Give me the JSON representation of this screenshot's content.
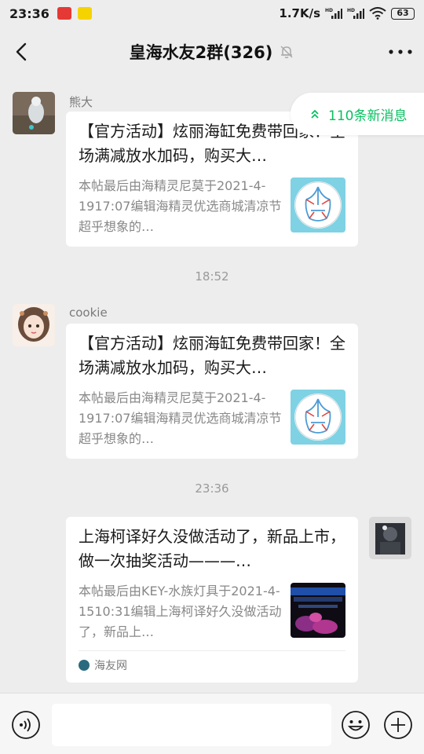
{
  "status_bar": {
    "time": "23:36",
    "network_speed": "1.7K/s",
    "signal_label_1": "HD",
    "signal_label_2": "HD",
    "battery": "63"
  },
  "header": {
    "title": "皇海水友2群(326)",
    "icons": [
      "back-icon",
      "mute-bell-icon",
      "more-icon"
    ]
  },
  "new_messages": {
    "label": "110条新消息",
    "icon": "double-chevron-up-icon",
    "accent": "#07c160"
  },
  "messages": [
    {
      "sender": "熊大",
      "title": "【官方活动】炫丽海缸免费带回家！全场满减放水加码，购买大…",
      "description": "本帖最后由海精灵尼莫于2021-4-1917:07编辑海精灵优选商城清凉节超乎想象的…",
      "thumbnail": "circular-logo"
    },
    {
      "time": "18:52"
    },
    {
      "sender": "cookie",
      "title": "【官方活动】炫丽海缸免费带回家！全场满减放水加码，购买大…",
      "description": "本帖最后由海精灵尼莫于2021-4-1917:07编辑海精灵优选商城清凉节超乎想象的…",
      "thumbnail": "circular-logo"
    },
    {
      "time": "23:36"
    },
    {
      "sender": "me",
      "title": "上海柯译好久没做活动了，新品上市，做一次抽奖活动———…",
      "description": "本帖最后由KEY-水族灯具于2021-4-1510:31编辑上海柯译好久没做活动了，新品上…",
      "thumbnail": "aquarium-lamp-photo",
      "source": "海友网"
    }
  ],
  "input_bar": {
    "placeholder": "",
    "icons": [
      "voice-icon",
      "emoji-icon",
      "plus-icon"
    ]
  }
}
